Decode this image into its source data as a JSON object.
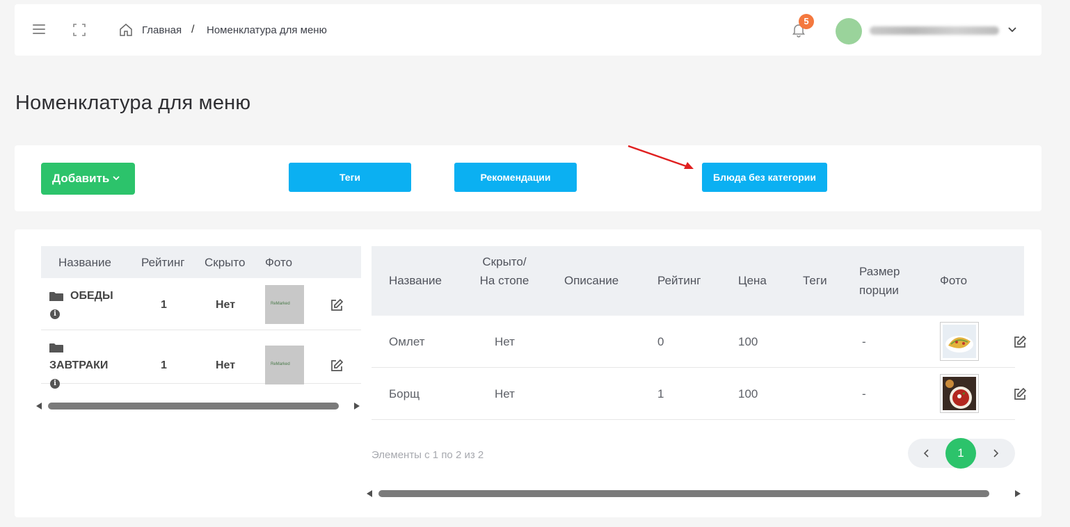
{
  "header": {
    "breadcrumb_home": "Главная",
    "breadcrumb_sep": "/",
    "breadcrumb_current": "Номенклатура для меню",
    "notifications_count": "5"
  },
  "page_title": "Номенклатура для меню",
  "toolbar": {
    "add_label": "Добавить",
    "tags_label": "Теги",
    "recommendations_label": "Рекомендации",
    "uncategorized_label": "Блюда без категории"
  },
  "categories": {
    "columns": [
      "Название",
      "Рейтинг",
      "Скрыто",
      "Фото"
    ],
    "rows": [
      {
        "name": "ОБЕДЫ",
        "rating": "1",
        "hidden": "Нет",
        "photo_text": "ReMarked"
      },
      {
        "name": "ЗАВТРАКИ",
        "rating": "1",
        "hidden": "Нет",
        "photo_text": "ReMarked"
      }
    ]
  },
  "dishes": {
    "columns": {
      "name": "Название",
      "hidden": "Скрыто/ На стопе",
      "description": "Описание",
      "rating": "Рейтинг",
      "price": "Цена",
      "tags": "Теги",
      "portion": "Размер порции",
      "photo": "Фото"
    },
    "rows": [
      {
        "name": "Омлет",
        "hidden": "Нет",
        "description": "",
        "rating": "0",
        "price": "100",
        "tags": "",
        "portion": "-"
      },
      {
        "name": "Борщ",
        "hidden": "Нет",
        "description": "",
        "rating": "1",
        "price": "100",
        "tags": "",
        "portion": "-"
      }
    ]
  },
  "pagination": {
    "info": "Элементы с 1 по 2 из 2",
    "current_page": "1"
  },
  "colors": {
    "green": "#2cc36b",
    "blue": "#0bb0f2",
    "badge": "#f4783e",
    "annotation_arrow": "#e02020"
  }
}
